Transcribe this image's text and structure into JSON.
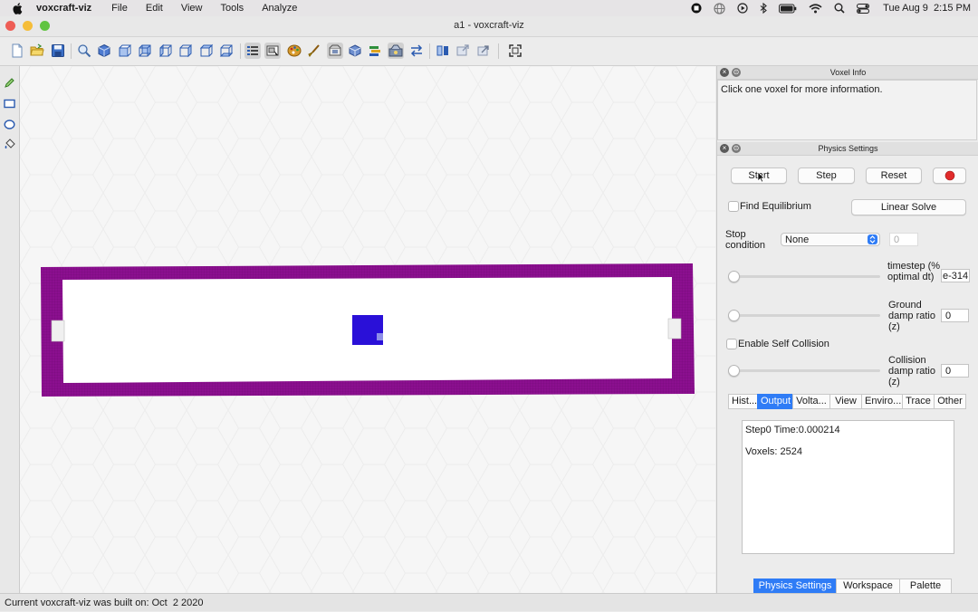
{
  "menubar": {
    "app_name": "voxcraft-viz",
    "menus": [
      "File",
      "Edit",
      "View",
      "Tools",
      "Analyze"
    ],
    "clock": "Tue Aug 9  2:15 PM"
  },
  "window": {
    "title": "a1 - voxcraft-viz"
  },
  "voxel_info": {
    "title": "Voxel Info",
    "message": "Click one voxel for more information."
  },
  "physics": {
    "title": "Physics Settings",
    "start_label": "Start",
    "step_label": "Step",
    "reset_label": "Reset",
    "record_color": "#e02b2b",
    "find_equilibrium_label": "Find Equilibrium",
    "linear_solve_label": "Linear Solve",
    "stop_condition_label": "Stop condition",
    "stop_condition_value": "None",
    "stop_condition_number": "0",
    "timestep_label": "timestep (% optimal dt)",
    "timestep_value": "e-314",
    "ground_damp_label": "Ground damp ratio (z)",
    "ground_damp_value": "0",
    "self_collision_label": "Enable Self Collision",
    "collision_damp_label": "Collision damp ratio (z)",
    "collision_damp_value": "0",
    "tabs": [
      "Hist...",
      "Output",
      "Volta...",
      "View",
      "Enviro...",
      "Trace",
      "Other"
    ],
    "selected_tab": "Output",
    "output_line1": "Step0 Time:0.000214",
    "output_line2": "Voxels: 2524"
  },
  "bottom_tabs": [
    "Physics Settings",
    "Workspace",
    "Palette"
  ],
  "selected_bottom_tab": "Physics Settings",
  "status": "Current voxcraft-viz was built on: Oct  2 2020",
  "colors": {
    "frame": "#8b0f8f",
    "block": "#2a10d8",
    "accent": "#2f7cf6"
  },
  "icons": {
    "menubar_right": [
      "screen-record-icon",
      "globe-icon",
      "play-circle-icon",
      "bluetooth-icon",
      "battery-icon",
      "wifi-icon",
      "search-icon",
      "control-center-icon"
    ],
    "toolbar": [
      "new-file-icon",
      "open-folder-icon",
      "save-icon",
      "zoom-icon",
      "view-iso-icon",
      "view-front-icon",
      "view-back-icon",
      "view-left-icon",
      "view-right-icon",
      "view-top-icon",
      "view-bottom-icon",
      "list-icon",
      "select-icon",
      "palette-icon",
      "brush-icon",
      "layer-icon",
      "cube-icon",
      "layers-icon",
      "settings-icon",
      "arrows-icon",
      "import-icon",
      "export-icon",
      "link-icon",
      "fullscreen-icon"
    ],
    "leftbar": [
      "pencil-icon",
      "rectangle-icon",
      "circle-icon",
      "bucket-icon"
    ]
  }
}
